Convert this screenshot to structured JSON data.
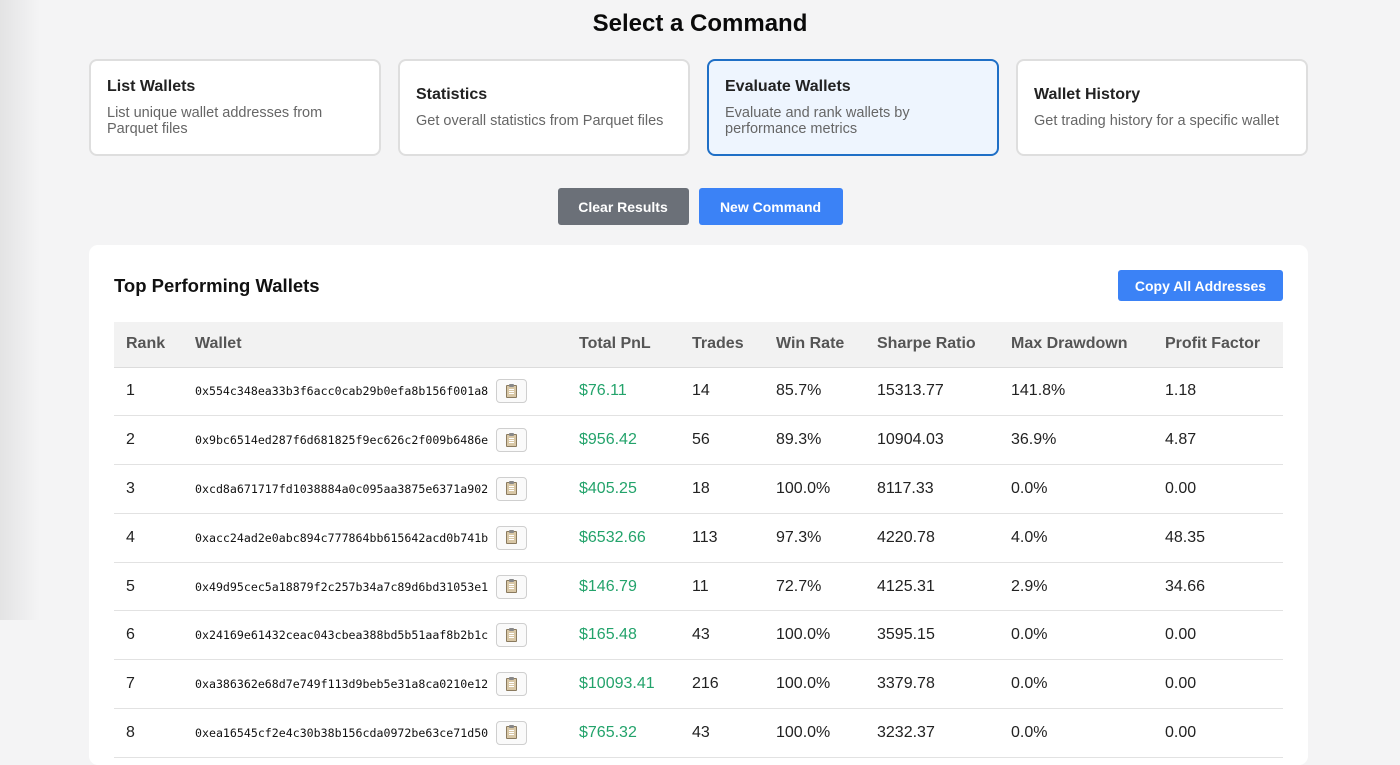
{
  "page_title": "Select a Command",
  "commands": [
    {
      "title": "List Wallets",
      "description": "List unique wallet addresses from Parquet files",
      "active": false
    },
    {
      "title": "Statistics",
      "description": "Get overall statistics from Parquet files",
      "active": false
    },
    {
      "title": "Evaluate Wallets",
      "description": "Evaluate and rank wallets by performance metrics",
      "active": true
    },
    {
      "title": "Wallet History",
      "description": "Get trading history for a specific wallet",
      "active": false
    }
  ],
  "actions": {
    "clear_label": "Clear Results",
    "new_label": "New Command"
  },
  "results": {
    "title": "Top Performing Wallets",
    "copy_all_label": "Copy All Addresses",
    "columns": [
      "Rank",
      "Wallet",
      "Total PnL",
      "Trades",
      "Win Rate",
      "Sharpe Ratio",
      "Max Drawdown",
      "Profit Factor"
    ],
    "rows": [
      {
        "rank": "1",
        "wallet": "0x554c348ea33b3f6acc0cab29b0efa8b156f001a8",
        "pnl": "$76.11",
        "trades": "14",
        "win_rate": "85.7%",
        "sharpe": "15313.77",
        "max_dd": "141.8%",
        "profit_factor": "1.18"
      },
      {
        "rank": "2",
        "wallet": "0x9bc6514ed287f6d681825f9ec626c2f009b6486e",
        "pnl": "$956.42",
        "trades": "56",
        "win_rate": "89.3%",
        "sharpe": "10904.03",
        "max_dd": "36.9%",
        "profit_factor": "4.87"
      },
      {
        "rank": "3",
        "wallet": "0xcd8a671717fd1038884a0c095aa3875e6371a902",
        "pnl": "$405.25",
        "trades": "18",
        "win_rate": "100.0%",
        "sharpe": "8117.33",
        "max_dd": "0.0%",
        "profit_factor": "0.00"
      },
      {
        "rank": "4",
        "wallet": "0xacc24ad2e0abc894c777864bb615642acd0b741b",
        "pnl": "$6532.66",
        "trades": "113",
        "win_rate": "97.3%",
        "sharpe": "4220.78",
        "max_dd": "4.0%",
        "profit_factor": "48.35"
      },
      {
        "rank": "5",
        "wallet": "0x49d95cec5a18879f2c257b34a7c89d6bd31053e1",
        "pnl": "$146.79",
        "trades": "11",
        "win_rate": "72.7%",
        "sharpe": "4125.31",
        "max_dd": "2.9%",
        "profit_factor": "34.66"
      },
      {
        "rank": "6",
        "wallet": "0x24169e61432ceac043cbea388bd5b51aaf8b2b1c",
        "pnl": "$165.48",
        "trades": "43",
        "win_rate": "100.0%",
        "sharpe": "3595.15",
        "max_dd": "0.0%",
        "profit_factor": "0.00"
      },
      {
        "rank": "7",
        "wallet": "0xa386362e68d7e749f113d9beb5e31a8ca0210e12",
        "pnl": "$10093.41",
        "trades": "216",
        "win_rate": "100.0%",
        "sharpe": "3379.78",
        "max_dd": "0.0%",
        "profit_factor": "0.00"
      },
      {
        "rank": "8",
        "wallet": "0xea16545cf2e4c30b38b156cda0972be63ce71d50",
        "pnl": "$765.32",
        "trades": "43",
        "win_rate": "100.0%",
        "sharpe": "3232.37",
        "max_dd": "0.0%",
        "profit_factor": "0.00"
      }
    ]
  },
  "icons": {
    "copy_row": "clipboard-icon"
  },
  "colors": {
    "accent": "#3b82f6",
    "active_border": "#1f6fc6",
    "active_bg": "#eef5fe",
    "pnl_positive": "#23a36b",
    "gray_button": "#6b7078"
  }
}
